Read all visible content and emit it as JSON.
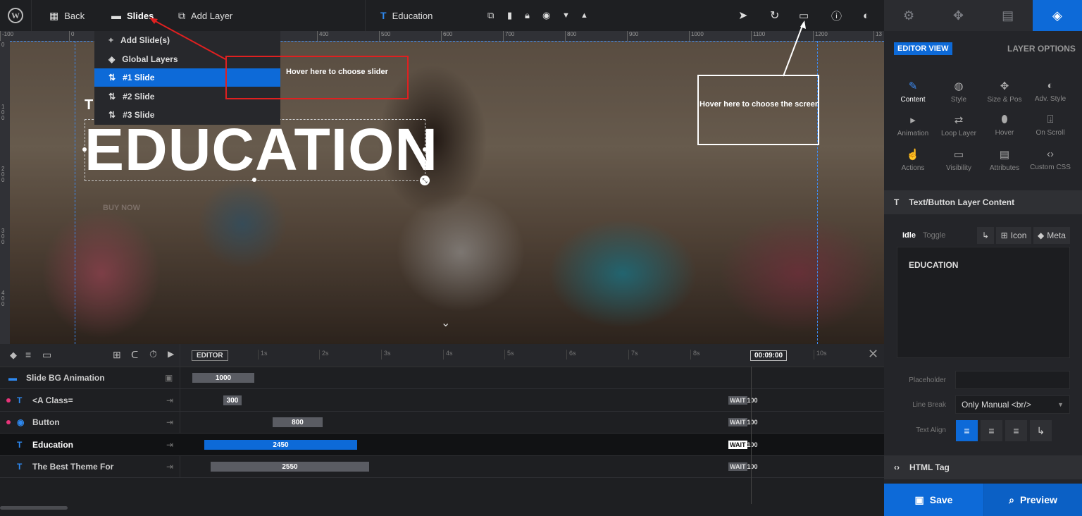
{
  "topbar": {
    "back_label": "Back",
    "slides_label": "Slides",
    "add_layer_label": "Add Layer",
    "current_layer_label": "Education"
  },
  "right_tabs": [
    "gear-icon",
    "move-icon",
    "image-icon",
    "layers-icon"
  ],
  "ruler": {
    "labels": [
      "-100",
      "0",
      "400",
      "500",
      "600",
      "700",
      "800",
      "900",
      "1000",
      "1100",
      "1200",
      "13"
    ],
    "vertical_labels": [
      "0",
      "100",
      "200",
      "300",
      "400"
    ]
  },
  "slides_menu": {
    "items": [
      "Add Slide(s)",
      "Global Layers",
      "#1 Slide",
      "#2 Slide",
      "#3 Slide"
    ],
    "active_index": 2
  },
  "canvas": {
    "heading": "EDUCATION",
    "first_letter": "T",
    "button_text": "BUY NOW"
  },
  "annotations": {
    "slider_hint": "Hover here to choose slider",
    "screen_hint": "Hover here to choose the screen"
  },
  "timeline": {
    "editor_label": "EDITOR",
    "time_label": "00:09:00",
    "seconds": [
      "1s",
      "2s",
      "3s",
      "4s",
      "5s",
      "6s",
      "7s",
      "8s",
      "10s"
    ],
    "rows": [
      {
        "name": "Slide BG Animation",
        "value": "1000",
        "wait": ""
      },
      {
        "name": "<A Class=",
        "value": "300",
        "wait": "WAIT",
        "wait_value": "100"
      },
      {
        "name": "Button",
        "value": "800",
        "wait": "WAIT",
        "wait_value": "100"
      },
      {
        "name": "Education",
        "value": "2450",
        "wait": "WAIT",
        "wait_value": "100"
      },
      {
        "name": "The Best Theme For",
        "value": "2550",
        "wait": "WAIT",
        "wait_value": "100"
      }
    ]
  },
  "right_panel": {
    "editor_view": "EDITOR VIEW",
    "layer_options": "LAYER OPTIONS",
    "options": [
      "Content",
      "Style",
      "Size & Pos",
      "Adv. Style",
      "Animation",
      "Loop Layer",
      "Hover",
      "On Scroll",
      "Actions",
      "Visibility",
      "Attributes",
      "Custom CSS"
    ],
    "section_title": "Text/Button Layer Content",
    "idle_label": "Idle",
    "toggle_label": "Toggle",
    "icon_label": "Icon",
    "meta_label": "Meta",
    "content_text": "EDUCATION",
    "placeholder_label": "Placeholder",
    "line_break_label": "Line Break",
    "line_break_value": "Only Manual <br/>",
    "text_align_label": "Text Align",
    "html_tag_label": "HTML Tag",
    "save_label": "Save",
    "preview_label": "Preview"
  }
}
